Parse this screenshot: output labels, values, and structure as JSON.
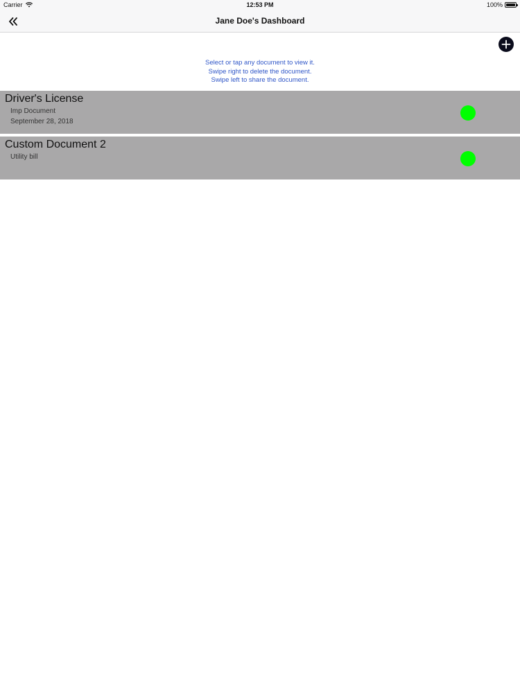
{
  "status_bar": {
    "carrier": "Carrier",
    "time": "12:53 PM",
    "battery_percent": "100%",
    "battery_level": 1.0
  },
  "nav": {
    "title": "Jane Doe's Dashboard",
    "back_icon": "double-chevron-left-icon",
    "add_icon": "plus-circle-icon"
  },
  "instructions": {
    "line1": "Select or tap any document to view it.",
    "line2": "Swipe right to delete the document.",
    "line3": "Swipe left to share the document."
  },
  "documents": [
    {
      "name": "Driver's License",
      "type": "Imp Document",
      "date": "September 28, 2018",
      "status_color": "#00ff00"
    },
    {
      "name": "Custom Document 2",
      "type": "Utility bill",
      "status_color": "#00ff00"
    }
  ],
  "colors": {
    "row_background": "#a9a8a9",
    "instruction_text": "#2e55c7",
    "add_button": "#0b0c1c"
  }
}
